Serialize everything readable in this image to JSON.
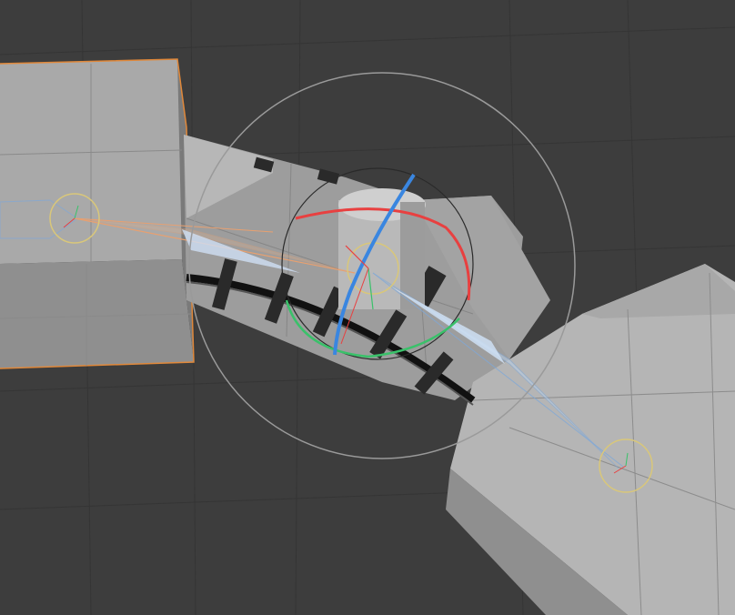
{
  "viewport": {
    "kind": "3d-viewport",
    "background": "#3d3d3d",
    "grid_color": "#2f2f2f"
  },
  "scene": {
    "objects": [
      {
        "name": "left-block",
        "selected": true,
        "outline_color": "#e0883a"
      },
      {
        "name": "middle-block",
        "selected": false
      },
      {
        "name": "right-block",
        "selected": false
      },
      {
        "name": "cylinder-joint",
        "selected": false
      },
      {
        "name": "curved-track",
        "selected": false
      }
    ],
    "bones": [
      {
        "name": "bone-left",
        "color": "#e8a070"
      },
      {
        "name": "bone-right",
        "color": "#7fa8d8"
      }
    ]
  },
  "gizmo": {
    "mode": "rotate",
    "axis_colors": {
      "x": "#e84040",
      "y": "#3ac16a",
      "z": "#3a86e0",
      "view": "#9a9a9a",
      "pivot": "#d9c77a"
    }
  }
}
